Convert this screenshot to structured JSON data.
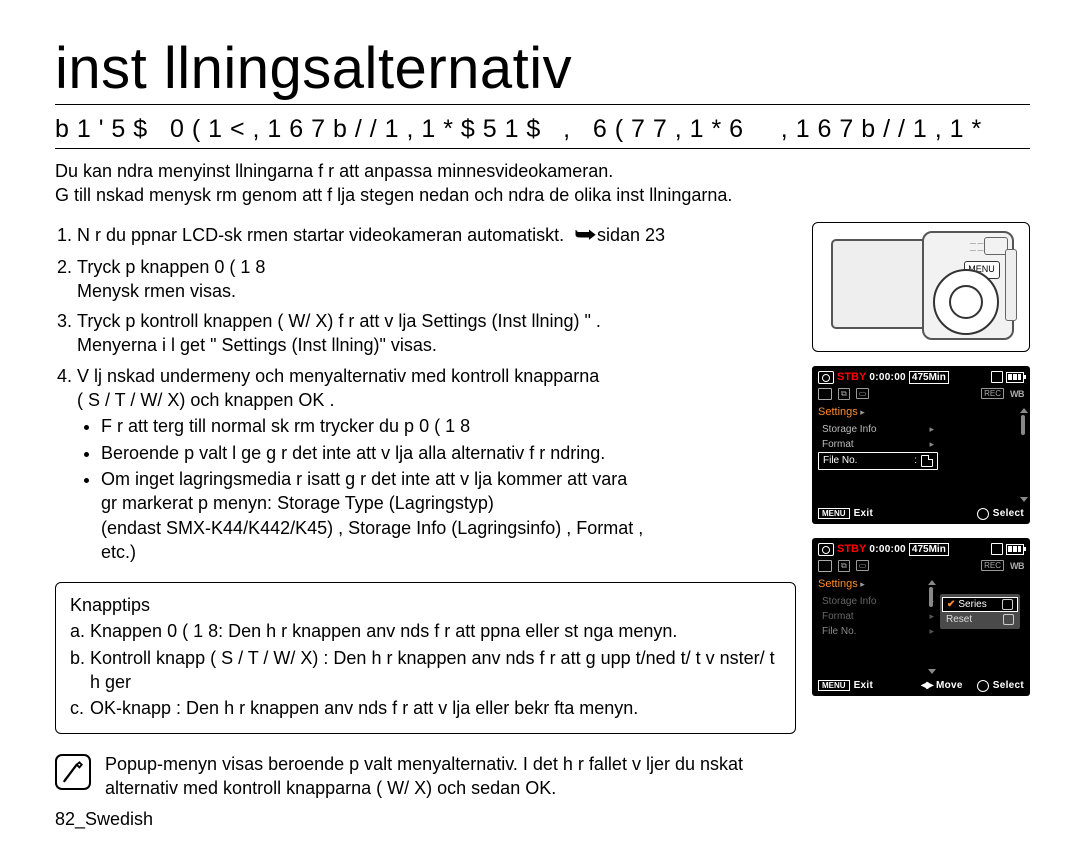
{
  "title": "inst llningsalternativ",
  "section": "b 1 ' 5 $   0 ( 1 < , 1 6 7 b / / 1 , 1 * $ 5 1 $   ,   6 ( 7 7 , 1 * 6     , 1 6 7 b / / 1 , 1 *",
  "intro1": "Du kan  ndra menyinst llningarna f r att anpassa minnesvideokameran.",
  "intro2": "G  till  nskad menysk rm genom att f lja stegen nedan och  ndra de olika inst llningarna.",
  "step1a": "N r du  ppnar LCD-sk rmen startar videokameran automatiskt.",
  "step1b": "sidan 23",
  "step2a": "Tryck p  knappen   0 ( 1 8",
  "step2b": "Menysk rmen  visas.",
  "step3a": "Tryck p   kontroll knappen (  W/  X) f r att v lja   Settings (Inst llning)   \" .",
  "step3b": "Menyerna i l get \" Settings (Inst llning)\"    visas.",
  "step4a": "V lj  nskad undermeny och menyalternativ med   kontroll knapparna",
  "step4b": "(  S /  T /  W/  X) och knappen OK .",
  "step4_b1": "F r att  terg  till normal sk rm trycker du p       0 ( 1 8",
  "step4_b2": "Beroende p  valt l ge g r det inte att v lja alla alternativ f r  ndring.",
  "step4_b3a": "Om inget lagringsmedia  r isatt g r det inte att v lja kommer att vara",
  "step4_b3b": "gr markerat p  menyn:   Storage Type (Lagringstyp)",
  "step4_b3c": "(endast SMX-K44/K442/K45) ,  Storage Info (Lagringsinfo) ,  Format ,",
  "step4_b3d": "etc.)",
  "tips_title": "Knapptips",
  "tips_a": "Knappen  0 ( 1 8: Den h r knappen anv nds f r att  ppna eller st nga menyn.",
  "tips_b": "Kontroll knapp (  S /  T /  W/  X)  : Den h r knappen anv nds f r att g upp t/ned t/ t v nster/ t h ger",
  "tips_c": "OK-knapp : Den h r knappen anv nds f r att v lja eller bekr fta menyn.",
  "note": "Popup-menyn visas beroende p  valt menyalternativ. I det h r fallet v ljer du  nskat alternativ med  kontroll knapparna (  W/  X) och sedan OK.",
  "footer": "82_Swedish",
  "camera": {
    "menu": "MENU"
  },
  "lcd": {
    "stby": "STBY",
    "clock": "0:00:00",
    "mins": "475Min",
    "settings": "Settings",
    "storage_info": "Storage Info",
    "format": "Format",
    "file_no": "File No.",
    "exit_btn": "MENU",
    "exit": "Exit",
    "select": "Select",
    "move": "Move",
    "wb": "WB",
    "rec": "REC",
    "series": "Series",
    "reset": "Reset"
  }
}
